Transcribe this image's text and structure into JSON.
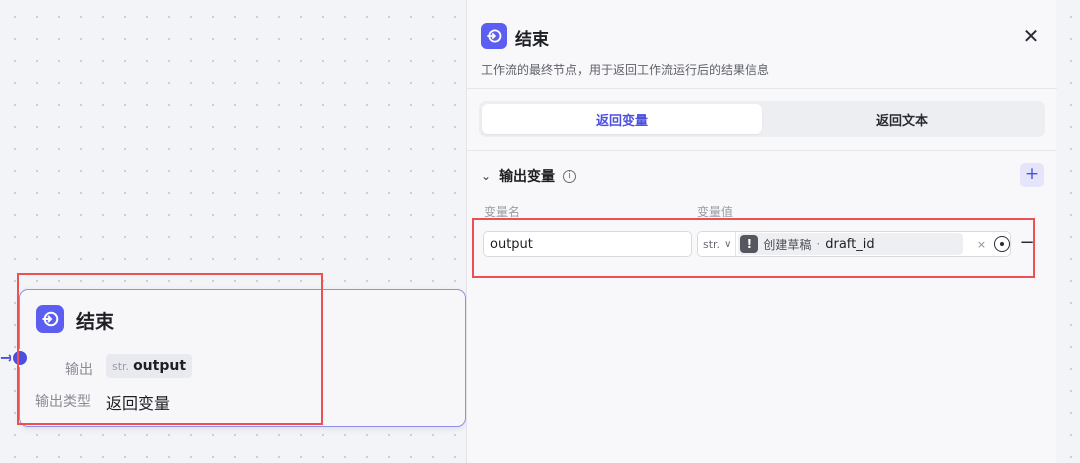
{
  "canvas_node": {
    "title": "结束",
    "output_label": "输出",
    "output_chip_type": "str.",
    "output_chip_name": "output",
    "output_type_label": "输出类型",
    "output_type_value": "返回变量",
    "icon": "end-node-icon"
  },
  "panel": {
    "title": "结束",
    "description": "工作流的最终节点，用于返回工作流运行后的结果信息",
    "close_icon": "close-icon",
    "tabs": [
      {
        "label": "返回变量",
        "active": true
      },
      {
        "label": "返回文本",
        "active": false
      }
    ],
    "section": {
      "title": "输出变量",
      "info_icon": "info-icon",
      "add_label": "+",
      "col_name_header": "变量名",
      "col_value_header": "变量值",
      "rows": [
        {
          "name_value": "output",
          "type": "str.",
          "ref_source": "创建草稿",
          "ref_separator": "·",
          "ref_field": "draft_id",
          "clear_label": "×",
          "remove_label": "−"
        }
      ]
    }
  },
  "colors": {
    "accent": "#5b5ef0",
    "highlight_box": "#ec5050"
  }
}
